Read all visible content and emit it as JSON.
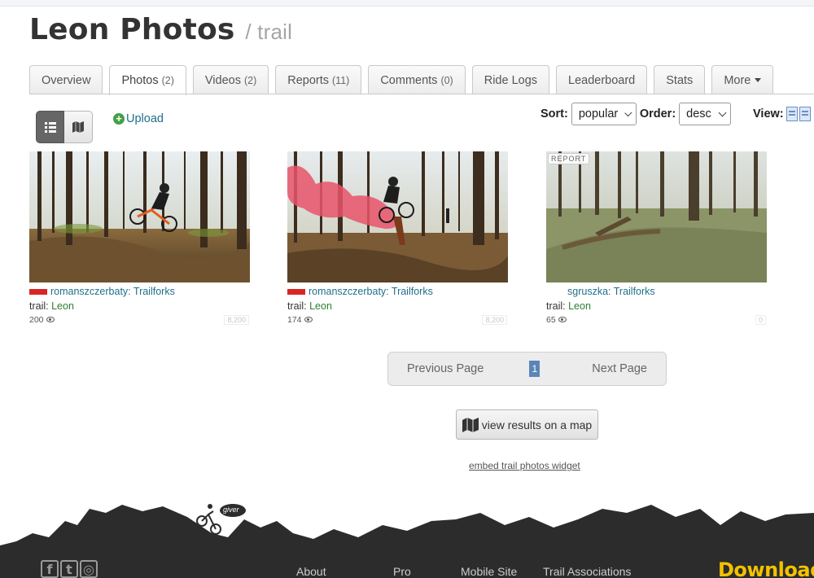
{
  "header": {
    "title": "Leon Photos",
    "subtitle": "/ trail"
  },
  "tabs": [
    {
      "label": "Overview",
      "count": ""
    },
    {
      "label": "Photos",
      "count": "(2)",
      "active": true
    },
    {
      "label": "Videos",
      "count": "(2)"
    },
    {
      "label": "Reports",
      "count": "(11)"
    },
    {
      "label": "Comments",
      "count": "(0)"
    },
    {
      "label": "Ride Logs",
      "count": ""
    },
    {
      "label": "Leaderboard",
      "count": ""
    },
    {
      "label": "Stats",
      "count": ""
    },
    {
      "label": "More",
      "count": ""
    }
  ],
  "toolbar": {
    "upload_label": "Upload",
    "sort_label": "Sort:",
    "sort_value": "popular",
    "order_label": "Order:",
    "order_value": "desc",
    "view_label": "View:"
  },
  "photos": [
    {
      "author": "romanszczerbaty: Trailforks",
      "trail_prefix": "trail:",
      "trail": "Leon",
      "views": "200",
      "score": "8,200",
      "flag": "poland",
      "badge": ""
    },
    {
      "author": "romanszczerbaty: Trailforks",
      "trail_prefix": "trail:",
      "trail": "Leon",
      "views": "174",
      "score": "8,200",
      "flag": "poland",
      "badge": ""
    },
    {
      "author": "sgruszka: Trailforks",
      "trail_prefix": "trail:",
      "trail": "Leon",
      "views": "65",
      "score": "0",
      "flag": "",
      "badge": "REPORT"
    }
  ],
  "pager": {
    "prev": "Previous Page",
    "current": "1",
    "next": "Next Page"
  },
  "map_button": "view results on a map",
  "embed_link": "embed trail photos widget",
  "footer": {
    "mascot_bubble": "giver",
    "links": [
      "About",
      "Pro",
      "Mobile Site",
      "Trail Associations"
    ],
    "download": "Download",
    "social": [
      "f",
      "t",
      "ig"
    ]
  },
  "colors": {
    "link": "#1f6f8b",
    "trail_link": "#2e7d32",
    "pager_active": "#5b85b7",
    "download": "#f2c200",
    "footer_dark": "#2c2c2c"
  }
}
